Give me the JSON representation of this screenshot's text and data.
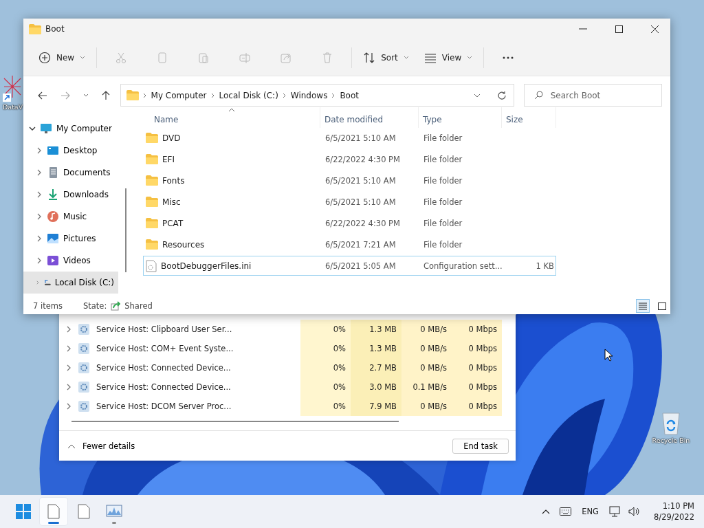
{
  "desktop_icons": [
    {
      "label": "DataV",
      "kind": "app"
    },
    {
      "label": "Recycle Bin",
      "kind": "recycle"
    }
  ],
  "task_manager": {
    "rows": [
      {
        "name": "Service Host: Clipboard User Ser...",
        "cpu": "0%",
        "memory": "1.3 MB",
        "disk": "0 MB/s",
        "network": "0 Mbps"
      },
      {
        "name": "Service Host: COM+ Event Syste...",
        "cpu": "0%",
        "memory": "1.3 MB",
        "disk": "0 MB/s",
        "network": "0 Mbps"
      },
      {
        "name": "Service Host: Connected Device...",
        "cpu": "0%",
        "memory": "2.7 MB",
        "disk": "0 MB/s",
        "network": "0 Mbps"
      },
      {
        "name": "Service Host: Connected Device...",
        "cpu": "0%",
        "memory": "3.0 MB",
        "disk": "0.1 MB/s",
        "network": "0 Mbps"
      },
      {
        "name": "Service Host: DCOM Server Proc...",
        "cpu": "0%",
        "memory": "7.9 MB",
        "disk": "0 MB/s",
        "network": "0 Mbps"
      }
    ],
    "fewer_details": "Fewer details",
    "end_task": "End task"
  },
  "explorer": {
    "title": "Boot",
    "toolbar": [
      {
        "kind": "new",
        "label": "New",
        "disabled": false
      },
      {
        "kind": "cut",
        "disabled": true
      },
      {
        "kind": "copy",
        "disabled": true
      },
      {
        "kind": "paste",
        "disabled": true
      },
      {
        "kind": "rename",
        "disabled": true
      },
      {
        "kind": "share",
        "disabled": true
      },
      {
        "kind": "delete",
        "disabled": true
      },
      {
        "kind": "sort",
        "label": "Sort",
        "disabled": false
      },
      {
        "kind": "view",
        "label": "View",
        "disabled": false
      },
      {
        "kind": "more",
        "disabled": false
      }
    ],
    "breadcrumbs": [
      "My Computer",
      "Local Disk (C:)",
      "Windows",
      "Boot"
    ],
    "search": {
      "placeholder": "Search Boot"
    },
    "nav": [
      {
        "label": "My Computer",
        "kind": "computer",
        "expanded": true,
        "selected": false,
        "children": [
          {
            "label": "Desktop",
            "kind": "desktop",
            "expanded": false,
            "selected": false
          },
          {
            "label": "Documents",
            "kind": "documents",
            "expanded": false,
            "selected": false
          },
          {
            "label": "Downloads",
            "kind": "downloads",
            "expanded": false,
            "selected": false
          },
          {
            "label": "Music",
            "kind": "music",
            "expanded": false,
            "selected": false
          },
          {
            "label": "Pictures",
            "kind": "pictures",
            "expanded": false,
            "selected": false
          },
          {
            "label": "Videos",
            "kind": "videos",
            "expanded": false,
            "selected": false
          },
          {
            "label": "Local Disk (C:)",
            "kind": "drive",
            "expanded": false,
            "selected": true
          }
        ]
      }
    ],
    "columns": [
      {
        "label": "Name",
        "sorted": true
      },
      {
        "label": "Date modified",
        "sorted": false
      },
      {
        "label": "Type",
        "sorted": false
      },
      {
        "label": "Size",
        "sorted": false
      }
    ],
    "rows": [
      {
        "name": "DVD",
        "kind": "folder",
        "date": "6/5/2021 5:10 AM",
        "type": "File folder",
        "selected": false
      },
      {
        "name": "EFI",
        "kind": "folder",
        "date": "6/22/2022 4:30 PM",
        "type": "File folder",
        "selected": false
      },
      {
        "name": "Fonts",
        "kind": "folder",
        "date": "6/5/2021 5:10 AM",
        "type": "File folder",
        "selected": false
      },
      {
        "name": "Misc",
        "kind": "folder",
        "date": "6/5/2021 5:10 AM",
        "type": "File folder",
        "selected": false
      },
      {
        "name": "PCAT",
        "kind": "folder",
        "date": "6/22/2022 4:30 PM",
        "type": "File folder",
        "selected": false
      },
      {
        "name": "Resources",
        "kind": "folder",
        "date": "6/5/2021 7:21 AM",
        "type": "File folder",
        "selected": false
      },
      {
        "name": "BootDebuggerFiles.ini",
        "kind": "settings",
        "date": "6/5/2021 5:05 AM",
        "type": "Configuration sett...",
        "size": "1 KB",
        "selected": true
      }
    ],
    "status": {
      "count": "7 items",
      "state_label": "State:",
      "state": "Shared"
    },
    "views": [
      {
        "kind": "details",
        "selected": true
      },
      {
        "kind": "tiles",
        "selected": false
      }
    ]
  },
  "taskbar": {
    "apps": [
      {
        "kind": "start",
        "active": false,
        "running": false
      },
      {
        "kind": "document",
        "active": true,
        "running": true
      },
      {
        "kind": "document",
        "active": false,
        "running": false
      },
      {
        "kind": "monitor",
        "active": false,
        "running": true
      }
    ],
    "language": "ENG",
    "time": "1:10 PM",
    "date": "8/29/2022"
  }
}
